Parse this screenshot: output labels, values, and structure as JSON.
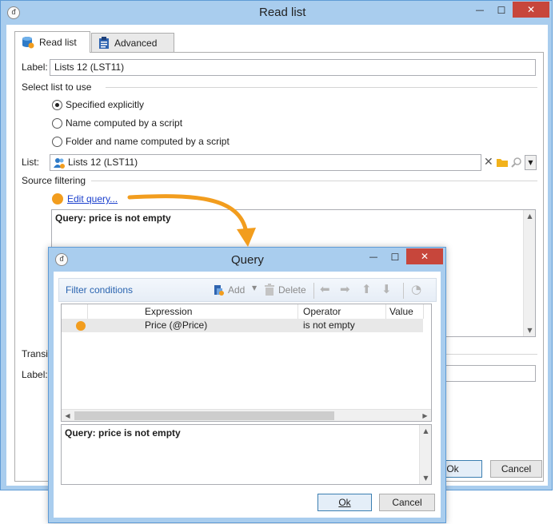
{
  "main_window": {
    "title": "Read list",
    "minimize": "—",
    "maximize": "☐",
    "close": "✕",
    "tabs": [
      {
        "label": "Read list",
        "icon": "database-icon"
      },
      {
        "label": "Advanced",
        "icon": "clipboard-icon"
      }
    ],
    "label_field": {
      "label": "Label:",
      "value": "Lists 12 (LST11)"
    },
    "select_list_section": "Select list to use",
    "radios": [
      {
        "label": "Specified explicitly",
        "checked": true
      },
      {
        "label": "Name computed by a script",
        "checked": false
      },
      {
        "label": "Folder and name computed by a script",
        "checked": false
      }
    ],
    "list_field": {
      "label": "List:",
      "value": "Lists 12 (LST11)"
    },
    "source_filtering_section": "Source filtering",
    "edit_query_link": "Edit query...",
    "query_text": "Query: price is not empty",
    "transition_section": "Transi",
    "transition_label": "Label:",
    "ok_button": "Ok",
    "cancel_button": "Cancel"
  },
  "query_dialog": {
    "title": "Query",
    "minimize": "—",
    "maximize": "☐",
    "close": "✕",
    "toolbar": {
      "filter_conditions": "Filter conditions",
      "add": "Add",
      "delete": "Delete"
    },
    "grid": {
      "columns": [
        "Expression",
        "Operator",
        "Value"
      ],
      "rows": [
        {
          "expression": "Price (@Price)",
          "operator": "is not empty",
          "value": ""
        }
      ]
    },
    "query_text": "Query: price is not empty",
    "ok_button": "Ok",
    "cancel_button": "Cancel"
  },
  "colors": {
    "title_bar": "#a9cdee",
    "accent_orange": "#f29d1e",
    "link": "#1a3fcc",
    "close_red": "#c7463b"
  }
}
